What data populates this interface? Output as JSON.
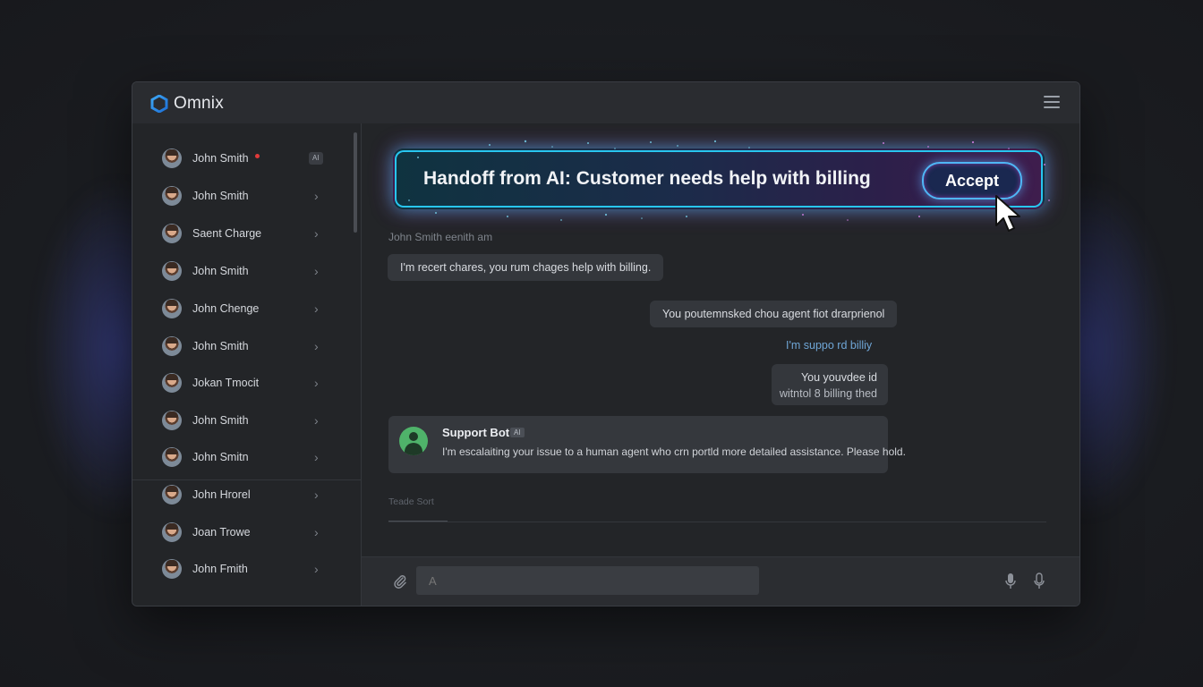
{
  "app": {
    "name": "Omnix"
  },
  "sidebar": {
    "contacts": [
      {
        "name": "John Smith",
        "unread": true,
        "badge": "AI"
      },
      {
        "name": "John Smith"
      },
      {
        "name": "Saent Charge"
      },
      {
        "name": "John Smith"
      },
      {
        "name": "John Chenge"
      },
      {
        "name": "John Smith"
      },
      {
        "name": "Jokan Tmocit"
      },
      {
        "name": "John Smith"
      },
      {
        "name": "John Smitn"
      },
      {
        "name": "John Hrorel"
      },
      {
        "name": "Joan Trowe"
      },
      {
        "name": "John Fmith"
      }
    ],
    "chevron": "›"
  },
  "banner": {
    "text": "Handoff from AI: Customer needs help with billing",
    "accept_label": "Accept"
  },
  "conversation": {
    "sender_label": "John Smith eenith am",
    "messages": [
      {
        "side": "left",
        "text": "I'm recert chares, you rum chages help with billing."
      },
      {
        "side": "right",
        "text": "You poutemnsked chou agent fiot drarprienol"
      },
      {
        "side": "right-plain",
        "text": "I'm suppo rd billiy"
      },
      {
        "side": "right",
        "lines": [
          "You youvdee id",
          "witntol 8 billing thed"
        ]
      }
    ],
    "bot": {
      "name": "Support Bot",
      "tag": "AI",
      "text": "I'm escalaiting your issue to a human agent who crn portld more detailed assistance. Please hold."
    },
    "tab_label": "Teade Sort"
  },
  "composer": {
    "placeholder": "A",
    "icons": [
      "paperclip-icon",
      "microphone-icon",
      "microphone-icon"
    ]
  },
  "colors": {
    "background": "#1b1d21",
    "window": "#242629",
    "accent_cyan": "#28c6f0",
    "accent_magenta": "#e040e6",
    "bot_green": "#4fb36a",
    "unread_red": "#e03a3a"
  }
}
